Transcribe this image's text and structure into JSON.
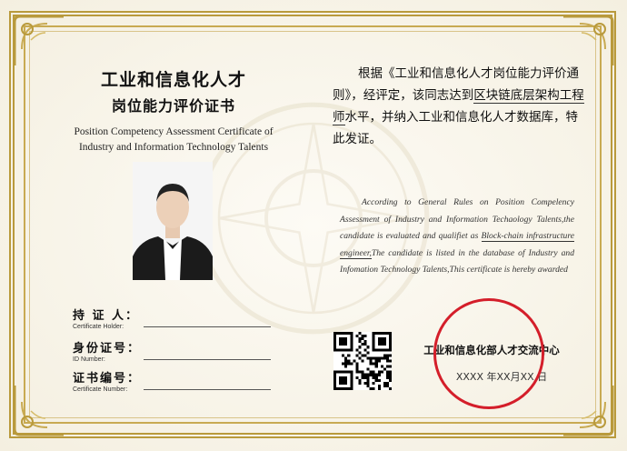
{
  "certificate": {
    "title_zh_line1": "工业和信息化人才",
    "title_zh_line2": "岗位能力评价证书",
    "title_en_line1": "Position Competency Assessment Certificate of",
    "title_en_line2": "Industry and Information Technology Talents",
    "colors": {
      "gold_border": "#b99a3c",
      "seal_red": "#d41e2a",
      "paper": "#f8f4e8"
    }
  },
  "fields": [
    {
      "label_zh": "持  证  人：",
      "label_en": "Certificate Holder:"
    },
    {
      "label_zh": "身份证号：",
      "label_en": "ID        Number:"
    },
    {
      "label_zh": "证书编号：",
      "label_en": "Certificate Number:"
    }
  ],
  "body_zh": {
    "part1": "根据《工业和信息化人才岗位能力评价通则》，经评定，该同志达到",
    "highlight": "区块链底层架构工程师",
    "part2": "水平，并纳入工业和信息化人才数据库，特此发证。"
  },
  "body_en": {
    "part1": "According to General Rules on Position Compelency Assessment of Industry and Information Techaology Talents,the candidate is evaluated and qualifiet as ",
    "highlight": "Block-chain infrastructure engineer,",
    "part2": "The candidate is listed in the database of Industry and Infomation Technology Talents,This certificate is hereby awarded"
  },
  "issuer": "工业和信息化部人才交流中心",
  "date": "XXXX 年XX月XX 日",
  "icons": {
    "photo": "person-photo",
    "qr": "qr-code-icon",
    "seal": "official-seal"
  }
}
